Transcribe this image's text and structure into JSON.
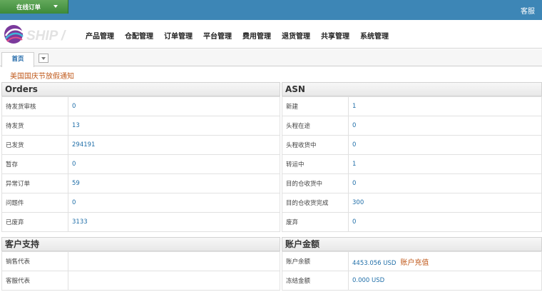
{
  "topbar": {
    "online_order": "在线订单",
    "service": "客服"
  },
  "logo": {
    "text": "SHIP /"
  },
  "nav": [
    "产品管理",
    "仓配管理",
    "订单管理",
    "平台管理",
    "费用管理",
    "退货管理",
    "共享管理",
    "系统管理"
  ],
  "tabs": {
    "home": "首页"
  },
  "notice": "美国国庆节放假通知",
  "orders": {
    "title": "Orders",
    "rows": [
      {
        "label": "待发货审核",
        "value": "0"
      },
      {
        "label": "待发货",
        "value": "13"
      },
      {
        "label": "已发货",
        "value": "294191"
      },
      {
        "label": "暂存",
        "value": "0"
      },
      {
        "label": "异常订单",
        "value": "59"
      },
      {
        "label": "问题件",
        "value": "0"
      },
      {
        "label": "已废弃",
        "value": "3133"
      }
    ]
  },
  "asn": {
    "title": "ASN",
    "rows": [
      {
        "label": "新建",
        "value": "1"
      },
      {
        "label": "头程在途",
        "value": "0"
      },
      {
        "label": "头程收货中",
        "value": "0"
      },
      {
        "label": "转运中",
        "value": "1"
      },
      {
        "label": "目的仓收货中",
        "value": "0"
      },
      {
        "label": "目的仓收货完成",
        "value": "300"
      },
      {
        "label": "废弃",
        "value": "0"
      }
    ]
  },
  "support": {
    "title": "客户支持",
    "rows": [
      {
        "label": "销售代表",
        "value": ""
      },
      {
        "label": "客服代表",
        "value": ""
      }
    ]
  },
  "account": {
    "title": "账户金额",
    "balance_label": "账户余额",
    "balance_value": "4453.056 USD",
    "recharge": "账户充值",
    "frozen_label": "冻结金额",
    "frozen_value": "0.000 USD"
  },
  "colors": {
    "topbar": "#3d86b6",
    "button": "#4f9a4a",
    "link": "#1f6ea8",
    "accent": "#c05a1c"
  }
}
